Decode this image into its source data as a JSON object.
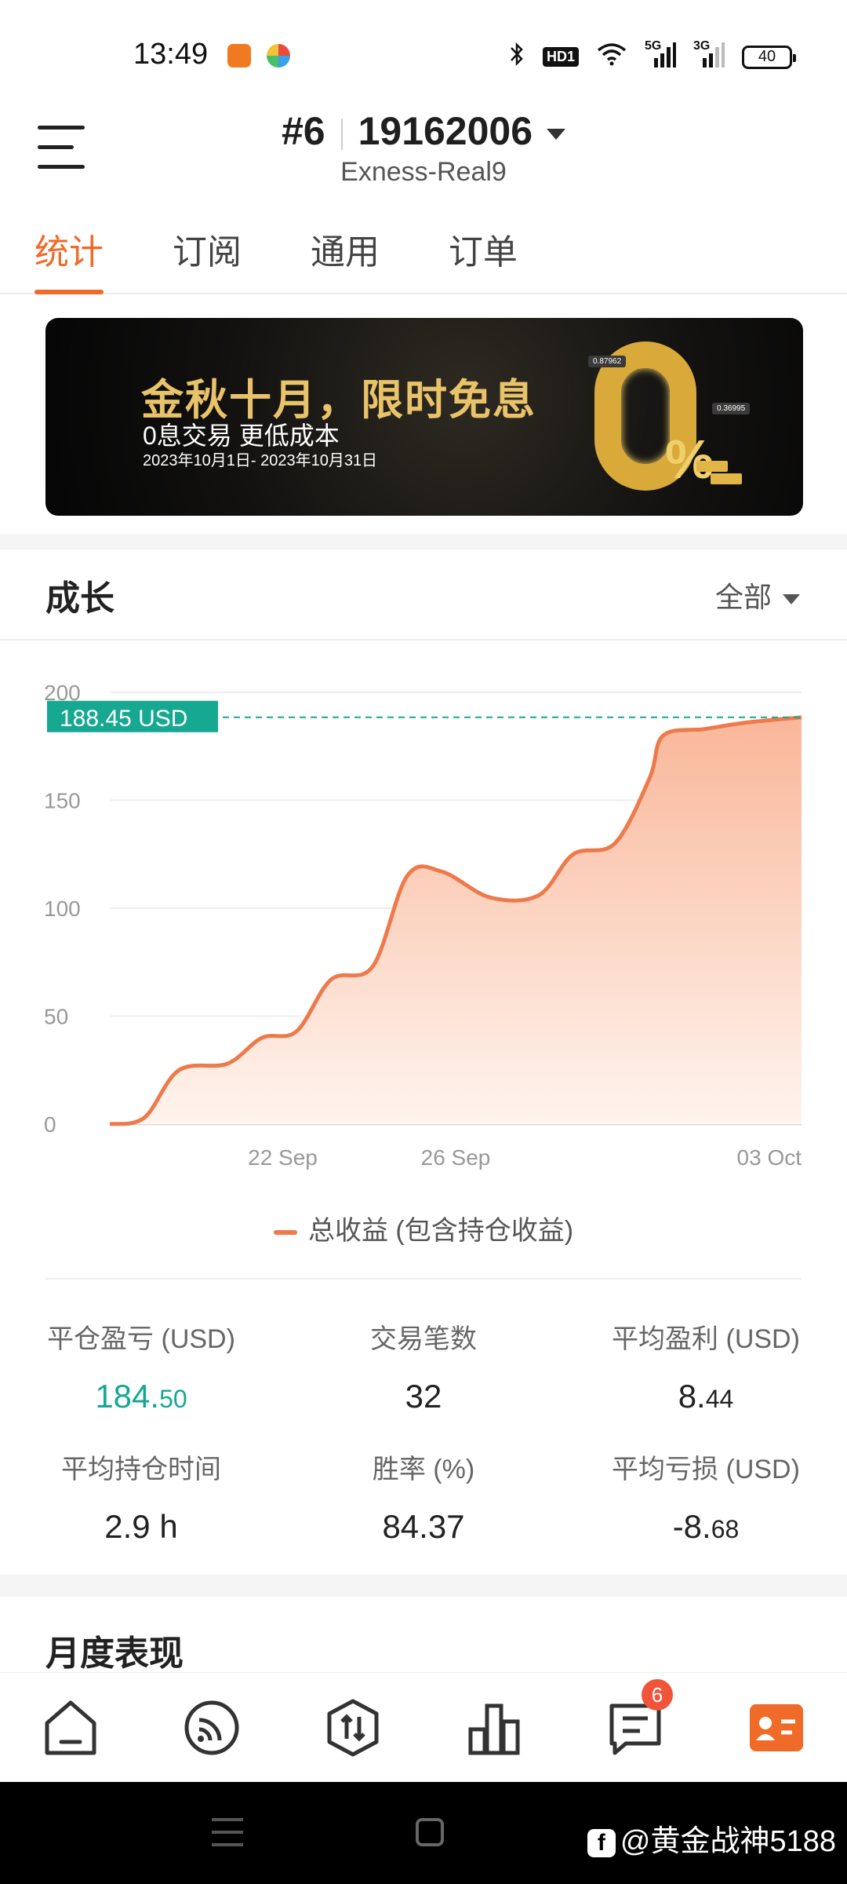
{
  "status_bar": {
    "time": "13:49",
    "battery": "40",
    "network_1": "5G",
    "network_2": "3G",
    "hd_label": "HD1"
  },
  "header": {
    "account_index": "#6",
    "account_number": "19162006",
    "server": "Exness-Real9"
  },
  "tabs": [
    {
      "label": "统计",
      "active": true
    },
    {
      "label": "订阅",
      "active": false
    },
    {
      "label": "通用",
      "active": false
    },
    {
      "label": "订单",
      "active": false
    }
  ],
  "banner": {
    "title": "金秋十月，限时免息",
    "subtitle": "0息交易 更低成本",
    "date_range": "2023年10月1日- 2023年10月31日",
    "big_zero": "0",
    "percent": "%",
    "tag_1": "0.87962",
    "tag_2": "0.36995"
  },
  "growth": {
    "title": "成长",
    "range": "全部",
    "current_value_label": "188.45 USD",
    "legend": "总收益 (包含持仓收益)"
  },
  "chart_data": {
    "type": "area",
    "series": [
      {
        "name": "总收益 (包含持仓收益)",
        "x": [
          0,
          0.05,
          0.1,
          0.17,
          0.22,
          0.27,
          0.32,
          0.38,
          0.43,
          0.48,
          0.55,
          0.62,
          0.67,
          0.73,
          0.78,
          0.8,
          0.86,
          0.92,
          1.0
        ],
        "values": [
          0,
          3,
          25,
          28,
          40,
          43,
          67,
          73,
          115,
          117,
          105,
          106,
          125,
          130,
          160,
          180,
          183,
          186,
          188.45
        ]
      }
    ],
    "x_tick_labels": [
      "22 Sep",
      "26 Sep",
      "03 Oct"
    ],
    "x_tick_positions": [
      0.25,
      0.5,
      1.0
    ],
    "y_ticks": [
      0,
      50,
      100,
      150,
      200
    ],
    "ylim": [
      0,
      200
    ],
    "reference_line": 188.45,
    "colors": {
      "line": "#ee7a4b",
      "fill_top": "#f9b79a",
      "fill_bottom": "#fff4ee",
      "reference": "#16a891"
    }
  },
  "stats": [
    {
      "label": "平仓盈亏 (USD)",
      "value_main": "184.",
      "value_small": "50",
      "green": true
    },
    {
      "label": "交易笔数",
      "value_main": "32",
      "value_small": "",
      "green": false
    },
    {
      "label": "平均盈利 (USD)",
      "value_main": "8.",
      "value_small": "44",
      "green": false
    },
    {
      "label": "平均持仓时间",
      "value_main": "2.9 h",
      "value_small": "",
      "green": false
    },
    {
      "label": "胜率 (%)",
      "value_main": "84.37",
      "value_small": "",
      "green": false
    },
    {
      "label": "平均亏损 (USD)",
      "value_main": "-8.",
      "value_small": "68",
      "green": false
    }
  ],
  "monthly": {
    "title": "月度表现"
  },
  "bottom_nav": {
    "messages_badge": "6"
  },
  "watermark": {
    "text": "@黄金战神5188"
  }
}
